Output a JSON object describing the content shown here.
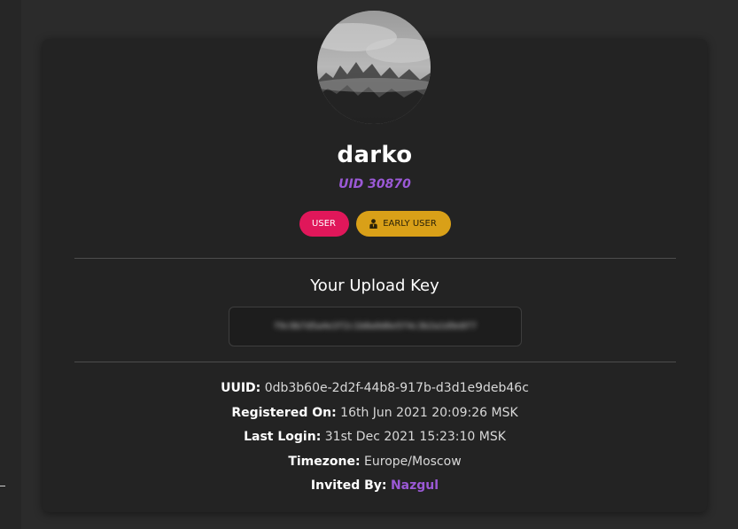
{
  "profile": {
    "username": "darko",
    "uid": "UID 30870"
  },
  "badges": {
    "user": "USER",
    "early_user": "EARLY USER",
    "early_user_icon": "user-tie-icon"
  },
  "upload_key": {
    "title": "Your Upload Key",
    "value": "f9c9b7d5a4e3f2c1b8a9d6e5f4c3b2a1d9e8f7"
  },
  "info": {
    "uuid_label": "UUID:",
    "uuid_value": "0db3b60e-2d2f-44b8-917b-d3d1e9deb46c",
    "registered_label": "Registered On:",
    "registered_value": "16th Jun 2021 20:09:26 MSK",
    "last_login_label": "Last Login:",
    "last_login_value": "31st Dec 2021 15:23:10 MSK",
    "timezone_label": "Timezone:",
    "timezone_value": "Europe/Moscow",
    "invited_label": "Invited By:",
    "invited_value": "Nazgul"
  },
  "colors": {
    "background": "#2b2b2b",
    "card": "#232323",
    "accent_purple": "#9b59d6",
    "badge_user": "#e0175a",
    "badge_early": "#d9a018"
  }
}
